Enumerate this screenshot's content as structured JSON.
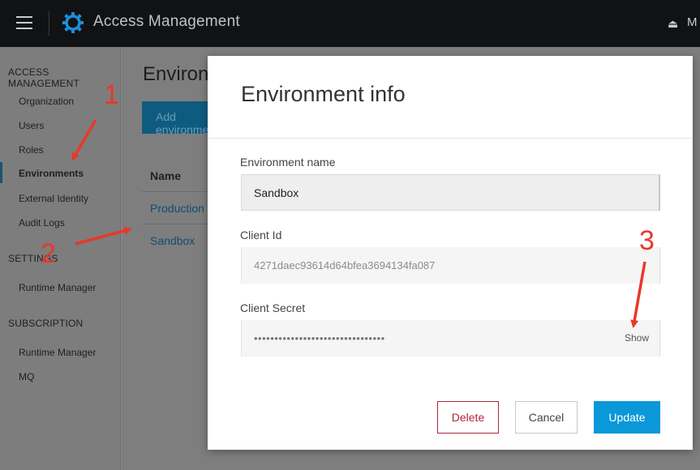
{
  "header": {
    "app_title": "Access Management",
    "user_label": "M",
    "brand_color": "#1a8fd6"
  },
  "sidebar": {
    "sections": [
      {
        "title": "ACCESS MANAGEMENT",
        "items": [
          "Organization",
          "Users",
          "Roles",
          "Environments",
          "External Identity",
          "Audit Logs"
        ]
      },
      {
        "title": "SETTINGS",
        "items": [
          "Runtime Manager"
        ]
      },
      {
        "title": "SUBSCRIPTION",
        "items": [
          "Runtime Manager",
          "MQ"
        ]
      }
    ],
    "active_item": "Environments"
  },
  "main": {
    "title": "Environments",
    "add_button": "Add environment",
    "table": {
      "column": "Name",
      "rows": [
        "Production",
        "Sandbox"
      ]
    }
  },
  "modal": {
    "title": "Environment info",
    "fields": {
      "env_name_label": "Environment name",
      "env_name_value": "Sandbox",
      "client_id_label": "Client Id",
      "client_id_value": "4271daec93614d64bfea3694134fa087",
      "client_secret_label": "Client Secret",
      "client_secret_value": "••••••••••••••••••••••••••••••••",
      "show_label": "Show"
    },
    "buttons": {
      "delete": "Delete",
      "cancel": "Cancel",
      "update": "Update"
    }
  },
  "annotations": {
    "labels": [
      "1",
      "2",
      "3"
    ],
    "color": "#e8382a"
  }
}
